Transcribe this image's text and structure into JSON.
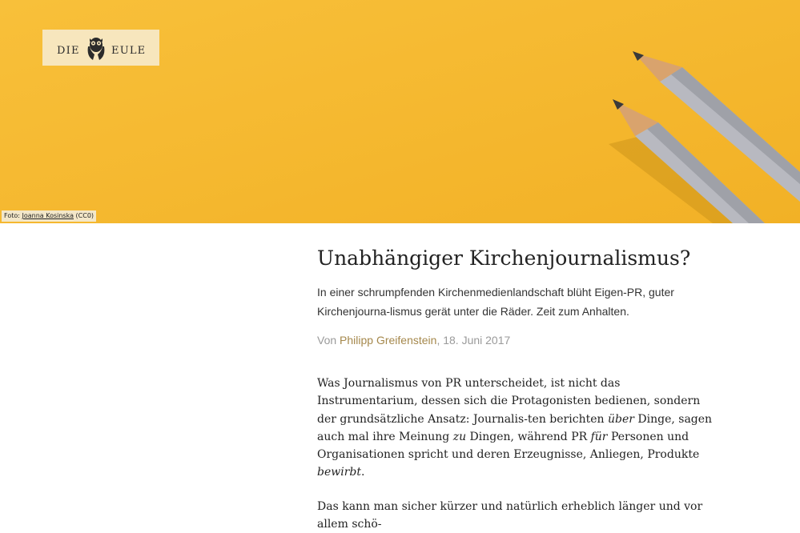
{
  "hero": {
    "logo": {
      "left": "DIE",
      "right": "EULE",
      "icon": "owl-icon"
    },
    "credit": {
      "prefix": "Foto: ",
      "author": "Joanna Kosinska",
      "license": " (CC0)"
    },
    "colors": {
      "background": "#f6b92c",
      "pencil": "#b8b9c0"
    }
  },
  "article": {
    "title": "Unabhängiger Kirchenjournalismus?",
    "lede": "In einer schrumpfenden Kirchenmedienlandschaft blüht Eigen-PR, guter Kirchenjourna-lismus gerät unter die Räder. Zeit zum Anhalten.",
    "byline": {
      "prefix": "Von ",
      "author": "Philipp Greifenstein",
      "date": ", 18. Juni 2017"
    },
    "paragraph1": {
      "t1": "Was Journalismus von PR unterscheidet, ist nicht das Instrumentarium, dessen sich die Protagonisten bedienen, sondern der grundsätzliche Ansatz: Journalis-ten berichten ",
      "em1": "über",
      "t2": " Dinge, sagen auch mal ihre Meinung ",
      "em2": "zu",
      "t3": " Dingen, während PR ",
      "em3": "für",
      "t4": " Personen und Organisationen spricht und deren Erzeugnisse, Anliegen, Produkte ",
      "em4": "bewirbt",
      "t5": "."
    },
    "paragraph2": "Das kann man sicher kürzer und natürlich erheblich länger und vor allem schö-"
  }
}
